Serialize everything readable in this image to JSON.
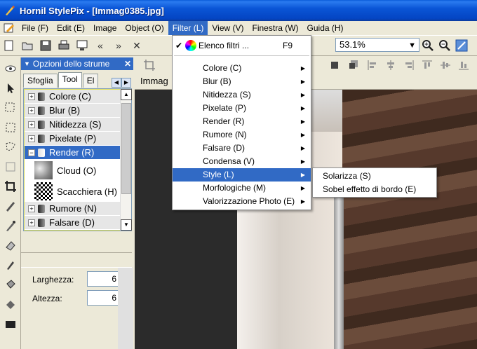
{
  "window": {
    "title": "Hornil StylePix - [Immag0385.jpg]"
  },
  "menubar": {
    "items": [
      "File (F)",
      "Edit (E)",
      "Image",
      "Object (O)",
      "Filter (L)",
      "View (V)",
      "Finestra (W)",
      "Guida (H)"
    ],
    "active": "Filter (L)"
  },
  "toolbar": {
    "zoom_value": "53.1%"
  },
  "panel": {
    "title": "Opzioni dello strume",
    "tabs": [
      "Sfoglia",
      "Tool",
      "El"
    ],
    "active_tab": "Tool",
    "tree": [
      {
        "label": "Colore (C)",
        "expanded": false
      },
      {
        "label": "Blur (B)",
        "expanded": false
      },
      {
        "label": "Nitidezza (S)",
        "expanded": false
      },
      {
        "label": "Pixelate (P)",
        "expanded": false
      },
      {
        "label": "Render (R)",
        "expanded": true,
        "selected": true
      },
      {
        "label": "Rumore (N)",
        "expanded": false
      },
      {
        "label": "Falsare (D)",
        "expanded": false
      }
    ],
    "render_children": [
      "Cloud (O)",
      "Scacchiera (H)"
    ],
    "width_label": "Larghezza:",
    "height_label": "Altezza:",
    "width_value": "6",
    "height_value": "6"
  },
  "document": {
    "tab_label": "Immag"
  },
  "filter_menu": {
    "first": {
      "label": "Elenco filtri ...",
      "shortcut": "F9",
      "checked": true
    },
    "items": [
      {
        "label": "Colore (C)",
        "submenu": true
      },
      {
        "label": "Blur (B)",
        "submenu": true
      },
      {
        "label": "Nitidezza (S)",
        "submenu": true
      },
      {
        "label": "Pixelate (P)",
        "submenu": true
      },
      {
        "label": "Render (R)",
        "submenu": true
      },
      {
        "label": "Rumore (N)",
        "submenu": true
      },
      {
        "label": "Falsare (D)",
        "submenu": true
      },
      {
        "label": "Condensa (V)",
        "submenu": true
      },
      {
        "label": "Style (L)",
        "submenu": true,
        "highlighted": true
      },
      {
        "label": "Morfologiche (M)",
        "submenu": true
      },
      {
        "label": "Valorizzazione Photo (E)",
        "submenu": true
      }
    ]
  },
  "style_submenu": {
    "items": [
      "Solarizza (S)",
      "Sobel effetto di bordo (E)"
    ]
  },
  "colors": {
    "titlebar": "#0a55d6",
    "highlight": "#316ac5",
    "chrome": "#ece9d8"
  }
}
